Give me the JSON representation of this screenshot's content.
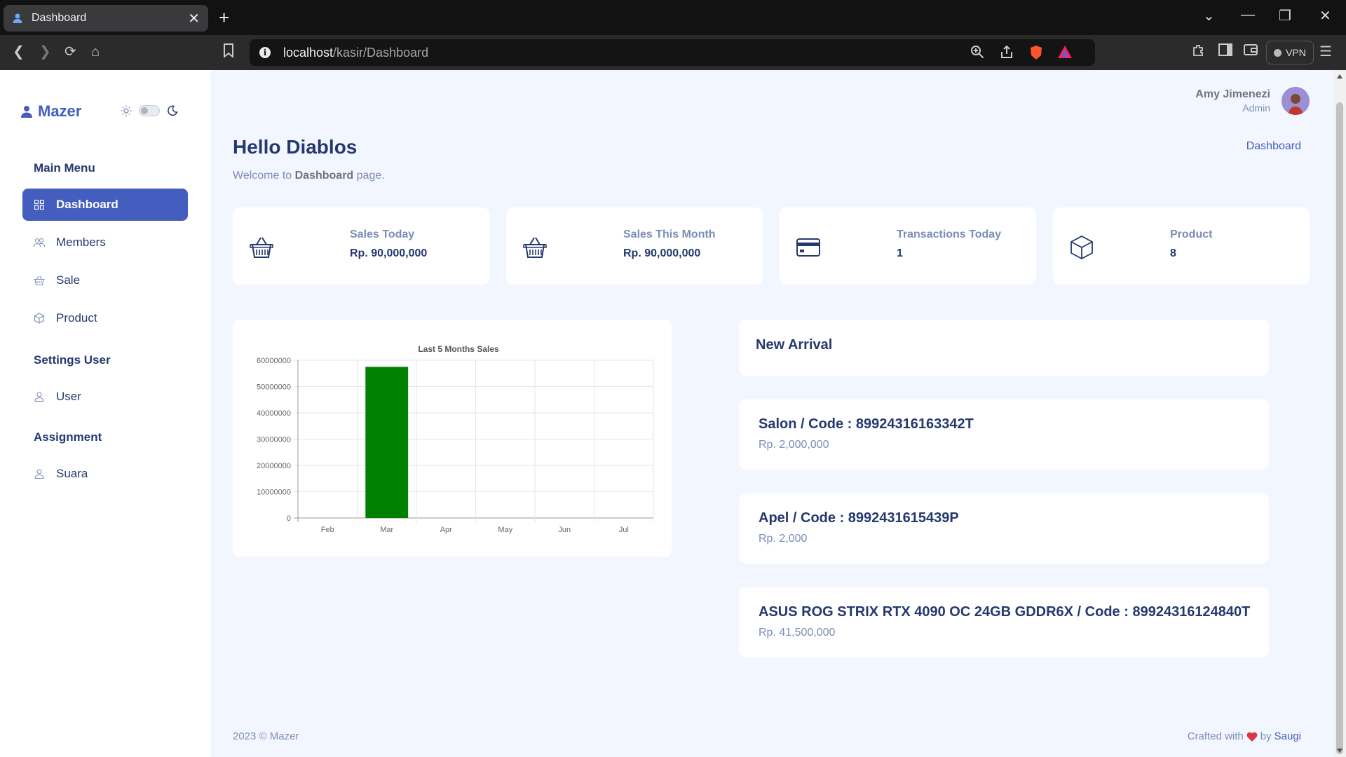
{
  "browser": {
    "tab_title": "Dashboard",
    "url_host": "localhost",
    "url_path": "/kasir/Dashboard",
    "vpn_label": "VPN"
  },
  "sidebar": {
    "logo": "Mazer",
    "sections": [
      {
        "title": "Main Menu"
      },
      {
        "title": "Settings User"
      },
      {
        "title": "Assignment"
      }
    ],
    "items": [
      {
        "label": "Dashboard",
        "icon": "grid-icon",
        "active": true
      },
      {
        "label": "Members",
        "icon": "people-icon"
      },
      {
        "label": "Sale",
        "icon": "basket-icon"
      },
      {
        "label": "Product",
        "icon": "box-icon"
      },
      {
        "label": "User",
        "icon": "person-icon"
      },
      {
        "label": "Suara",
        "icon": "person-icon"
      }
    ]
  },
  "header": {
    "user_name": "Amy Jimenezi",
    "user_role": "Admin",
    "greeting": "Hello Diablos",
    "sub_pre": "Welcome to ",
    "sub_bold": "Dashboard",
    "sub_post": " page.",
    "breadcrumb": "Dashboard"
  },
  "stats": [
    {
      "label": "Sales Today",
      "value": "Rp. 90,000,000",
      "icon": "basket-icon"
    },
    {
      "label": "Sales This Month",
      "value": "Rp. 90,000,000",
      "icon": "basket-icon"
    },
    {
      "label": "Transactions Today",
      "value": "1",
      "icon": "credit-card-icon"
    },
    {
      "label": "Product",
      "value": "8",
      "icon": "box-icon"
    }
  ],
  "chart_data": {
    "type": "bar",
    "title": "Last 5 Months Sales",
    "categories": [
      "Feb",
      "Mar",
      "Apr",
      "May",
      "Jun",
      "Jul"
    ],
    "values": [
      0,
      57500000,
      0,
      0,
      0,
      0
    ],
    "yticks": [
      "0",
      "10000000",
      "20000000",
      "30000000",
      "40000000",
      "50000000",
      "60000000"
    ],
    "ylim": [
      0,
      60000000
    ],
    "bar_color": "#008000",
    "grid": true
  },
  "new_arrival": {
    "title": "New Arrival",
    "items": [
      {
        "name": "Salon / Code : 89924316163342T",
        "price": "Rp. 2,000,000"
      },
      {
        "name": "Apel / Code : 8992431615439P",
        "price": "Rp. 2,000"
      },
      {
        "name": "ASUS ROG STRIX RTX 4090 OC 24GB GDDR6X / Code : 89924316124840T",
        "price": "Rp. 41,500,000"
      }
    ]
  },
  "footer": {
    "left": "2023 © Mazer",
    "crafted": "Crafted with",
    "by": "by",
    "author": "Saugi"
  },
  "colors": {
    "primary": "#435ebe",
    "heading": "#25396f",
    "muted": "#7c8db5",
    "bg": "#f2f7ff"
  }
}
